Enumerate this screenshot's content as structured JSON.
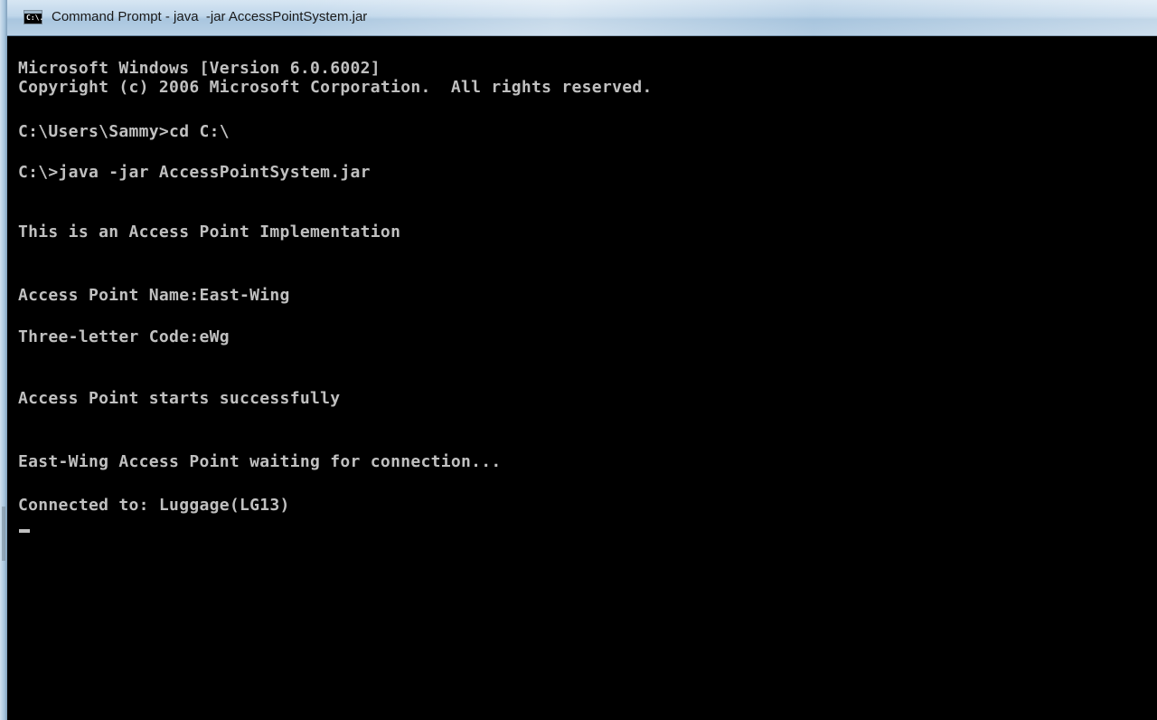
{
  "window": {
    "title": "Command Prompt - java  -jar AccessPointSystem.jar",
    "icon_name": "cmd-icon",
    "icon_text": "C:\\."
  },
  "console": {
    "lines": [
      "Microsoft Windows [Version 6.0.6002]",
      "Copyright (c) 2006 Microsoft Corporation.  All rights reserved.",
      "C:\\Users\\Sammy>cd C:\\",
      "C:\\>java -jar AccessPointSystem.jar",
      "This is an Access Point Implementation",
      "Access Point Name:East-Wing",
      "Three-letter Code:eWg",
      "Access Point starts successfully",
      "East-Wing Access Point waiting for connection...",
      "Connected to: Luggage(LG13)"
    ],
    "text_color": "#c0c0c0",
    "background_color": "#000000"
  }
}
